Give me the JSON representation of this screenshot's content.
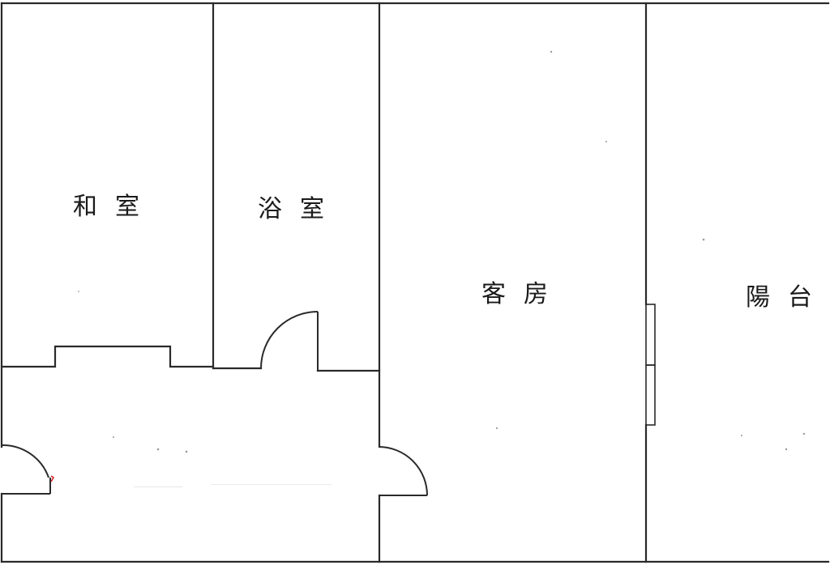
{
  "rooms": {
    "washitsu": {
      "label": "和室"
    },
    "bathroom": {
      "label": "浴室"
    },
    "guest_room": {
      "label": "客房"
    },
    "balcony": {
      "label": "陽台"
    }
  },
  "colors": {
    "wall": "#2a2a2a",
    "background": "#ffffff",
    "label": "#1a1a1a"
  }
}
